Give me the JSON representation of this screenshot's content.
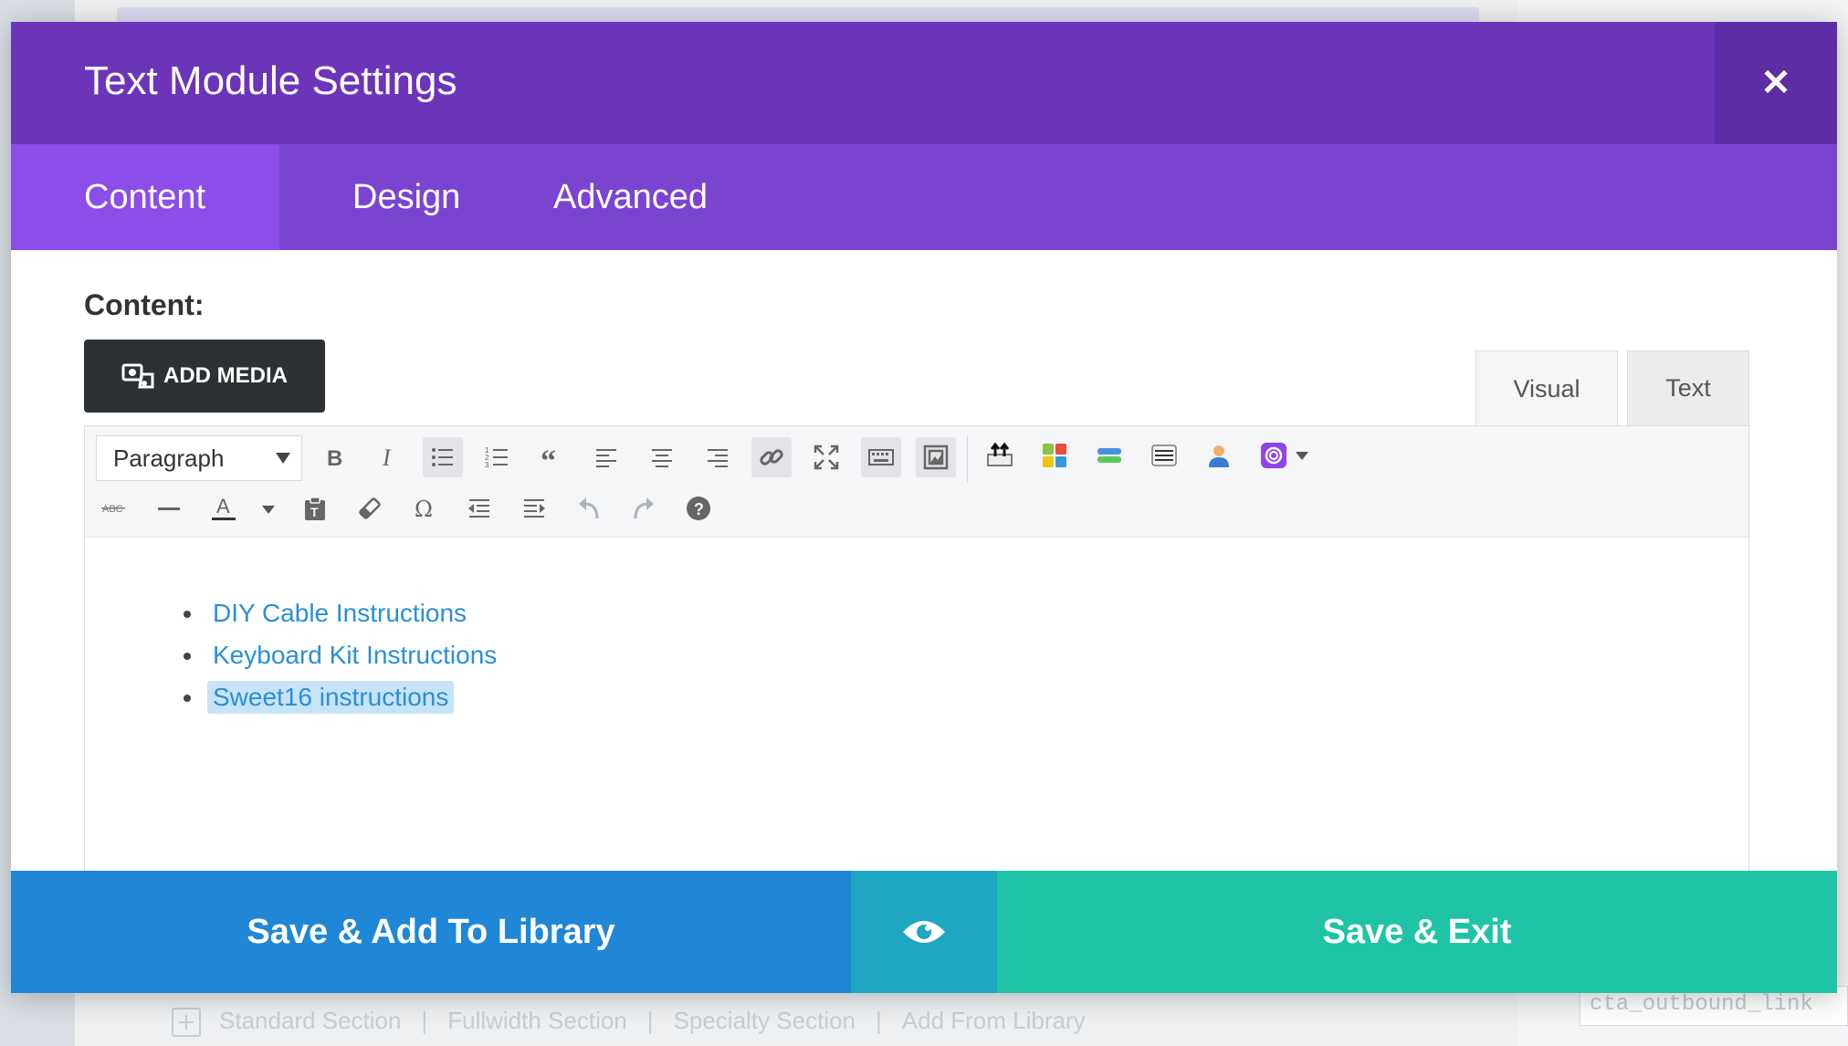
{
  "background": {
    "section_bar": {
      "items": [
        "Standard Section",
        "|",
        "Fullwidth Section",
        "|",
        "Specialty Section",
        "|",
        "Add From Library"
      ]
    },
    "right_input_value": "cta_outbound_link"
  },
  "modal": {
    "title": "Text Module Settings",
    "close_icon": "close-icon",
    "tabs": [
      {
        "label": "Content",
        "active": true
      },
      {
        "label": "Design",
        "active": false
      },
      {
        "label": "Advanced",
        "active": false
      }
    ],
    "content_label": "Content:",
    "add_media_label": "ADD MEDIA",
    "editor_tabs": {
      "visual": "Visual",
      "text": "Text",
      "active": "Visual"
    },
    "toolbar": {
      "format_value": "Paragraph",
      "row1_icons": [
        "bold-icon",
        "italic-icon",
        "bullet-list-icon",
        "numbered-list-icon",
        "blockquote-icon",
        "align-left-icon",
        "align-center-icon",
        "align-right-icon",
        "link-icon",
        "fullscreen-icon",
        "keyboard-icon",
        "image-frame-icon",
        "upload-icon",
        "color-grid-icon",
        "stack-icon",
        "lines-icon",
        "user-icon",
        "plugin-circle-icon",
        "dropdown-arrow-icon"
      ],
      "row2_icons": [
        "strikethrough-icon",
        "horizontal-rule-icon",
        "text-color-icon",
        "paste-text-icon",
        "clear-formatting-icon",
        "omega-icon",
        "outdent-icon",
        "indent-icon",
        "undo-icon",
        "redo-icon",
        "help-icon"
      ]
    },
    "content_items": [
      {
        "text": "DIY Cable Instructions",
        "selected": false
      },
      {
        "text": "Keyboard Kit Instructions",
        "selected": false
      },
      {
        "text": "Sweet16 instructions",
        "selected": true
      }
    ],
    "footer": {
      "library_label": "Save & Add To Library",
      "preview_icon": "eye-icon",
      "exit_label": "Save & Exit"
    }
  },
  "colors": {
    "header": "#6c34b8",
    "tabs": "#7b44d0",
    "active_tab": "#8c4de8",
    "library_button": "#1f87d6",
    "preview_button": "#1ea7c1",
    "exit_button": "#1fc4a6",
    "link": "#2a8fd6"
  }
}
